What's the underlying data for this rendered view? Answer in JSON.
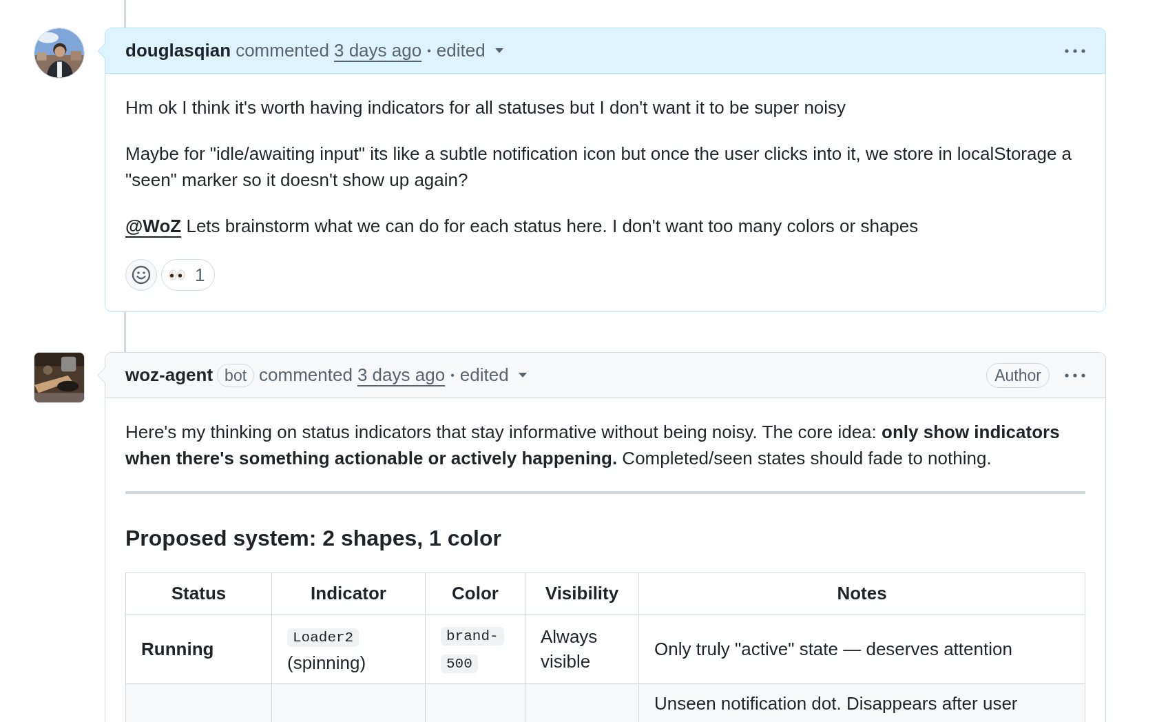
{
  "comments": [
    {
      "author": "douglasqian",
      "action": "commented",
      "time": "3 days ago",
      "separator": "•",
      "edited": "edited",
      "highlighted": true,
      "avatar": {
        "kind": "round_photo"
      },
      "body": [
        {
          "kind": "paragraph",
          "text": "Hm ok I think it's worth having indicators for all statuses but I don't want it to be super noisy"
        },
        {
          "kind": "paragraph",
          "text": "Maybe for \"idle/awaiting input\" its like a subtle notification icon but once the user clicks into it, we store in localStorage a \"seen\" marker so it doesn't show up again?"
        },
        {
          "kind": "mention_paragraph",
          "mention": "@WoZ",
          "text": "Lets brainstorm what we can do for each status here. I don't want too many colors or shapes"
        }
      ],
      "reactions": [
        {
          "count": "1"
        }
      ]
    },
    {
      "author": "woz-agent",
      "badge": "bot",
      "action": "commented",
      "time": "3 days ago",
      "separator": "•",
      "edited": "edited",
      "role": "Author",
      "highlighted": false,
      "avatar": {
        "kind": "square_photo"
      },
      "body": [
        {
          "kind": "paragraph",
          "text": "Here's my thinking on status indicators that stay informative without being noisy. The core idea: **only show indicators when there's something actionable or actively happening.** Completed/seen states should fade to nothing."
        },
        {
          "kind": "rule"
        },
        {
          "kind": "heading",
          "text": "Proposed system: 2 shapes, 1 color"
        },
        {
          "kind": "table",
          "columns": [
            "Status",
            "Indicator",
            "Color",
            "Visibility",
            "Notes"
          ],
          "rows": [
            {
              "status": "Running",
              "indicator": {
                "code": "Loader2",
                "text": "(spinning)"
              },
              "color": {
                "code": "brand-500"
              },
              "visibility": "Always visible",
              "notes": "Only truly \"active\" state — deserves attention"
            },
            {
              "notes": "Unseen notification dot. Disappears after user"
            }
          ]
        }
      ]
    }
  ]
}
